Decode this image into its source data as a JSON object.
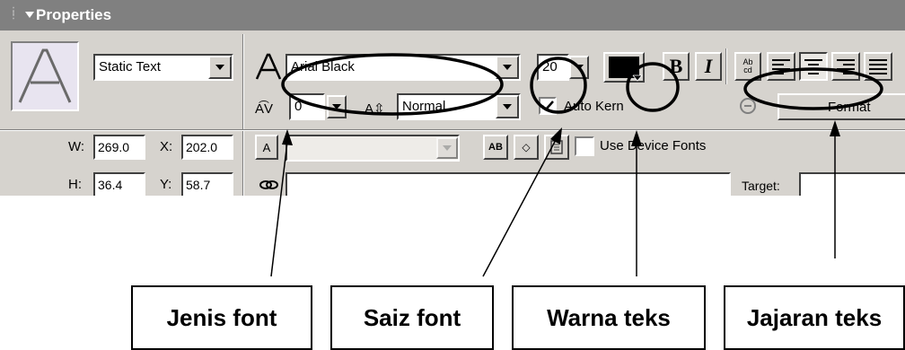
{
  "panel": {
    "title": "Properties",
    "text_type": "Static Text",
    "font_name": "Arial Black",
    "font_size": "20",
    "letter_spacing": "0",
    "baseline": "Normal",
    "bold_label": "B",
    "italic_label": "I",
    "auto_kern_label": "Auto Kern",
    "auto_kern_checked": true,
    "format_label": "Format",
    "device_fonts_label": "Use Device Fonts",
    "device_fonts_checked": false,
    "w_label": "W:",
    "w_value": "269.0",
    "x_label": "X:",
    "x_value": "202.0",
    "h_label": "H:",
    "h_value": "36.4",
    "y_label": "Y:",
    "y_value": "58.7",
    "target_label": "Target:",
    "text_color": "#000000",
    "ab_icon_label": "AB",
    "abc_icon_label": "Ab cd"
  },
  "annotations": {
    "font_type": "Jenis font",
    "font_size": "Saiz font",
    "text_color": "Warna teks",
    "text_alignment": "Jajaran teks"
  }
}
